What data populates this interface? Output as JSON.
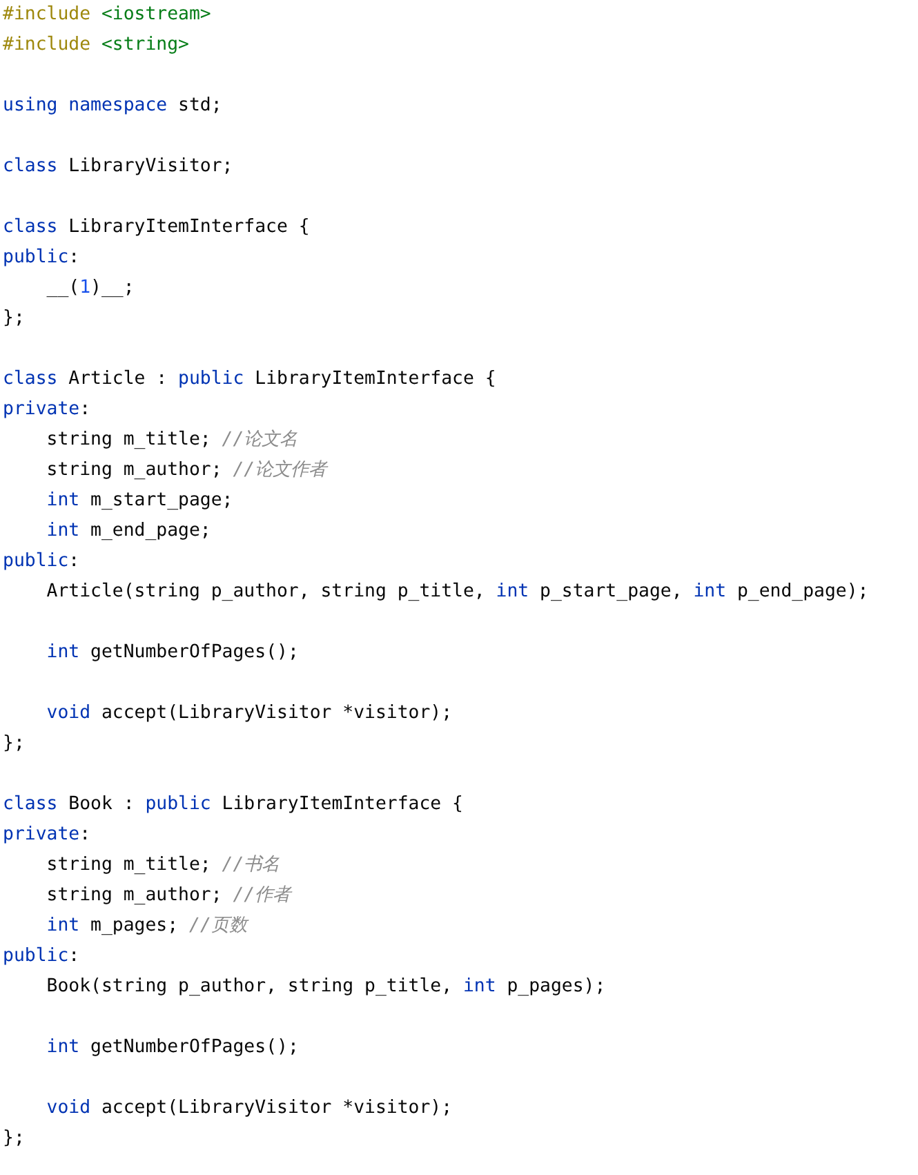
{
  "lines": [
    {
      "kind": "code",
      "tokens": [
        {
          "kind": "directive",
          "text": "#include "
        },
        {
          "kind": "string",
          "text": "<iostream>"
        }
      ]
    },
    {
      "kind": "code",
      "tokens": [
        {
          "kind": "directive",
          "text": "#include "
        },
        {
          "kind": "string",
          "text": "<string>"
        }
      ]
    },
    {
      "kind": "blank"
    },
    {
      "kind": "code",
      "tokens": [
        {
          "kind": "keyword",
          "text": "using namespace "
        },
        {
          "kind": "plain",
          "text": "std;"
        }
      ]
    },
    {
      "kind": "blank"
    },
    {
      "kind": "code",
      "tokens": [
        {
          "kind": "keyword",
          "text": "class "
        },
        {
          "kind": "plain",
          "text": "LibraryVisitor;"
        }
      ]
    },
    {
      "kind": "blank"
    },
    {
      "kind": "code",
      "tokens": [
        {
          "kind": "keyword",
          "text": "class "
        },
        {
          "kind": "plain",
          "text": "LibraryItemInterface {"
        }
      ]
    },
    {
      "kind": "code",
      "tokens": [
        {
          "kind": "keyword",
          "text": "public"
        },
        {
          "kind": "plain",
          "text": ":"
        }
      ]
    },
    {
      "kind": "code",
      "tokens": [
        {
          "kind": "plain",
          "text": "    __("
        },
        {
          "kind": "number",
          "text": "1"
        },
        {
          "kind": "plain",
          "text": ")__;"
        }
      ]
    },
    {
      "kind": "code",
      "tokens": [
        {
          "kind": "plain",
          "text": "};"
        }
      ]
    },
    {
      "kind": "blank"
    },
    {
      "kind": "code",
      "tokens": [
        {
          "kind": "keyword",
          "text": "class "
        },
        {
          "kind": "plain",
          "text": "Article : "
        },
        {
          "kind": "keyword",
          "text": "public "
        },
        {
          "kind": "plain",
          "text": "LibraryItemInterface {"
        }
      ]
    },
    {
      "kind": "code",
      "tokens": [
        {
          "kind": "keyword",
          "text": "private"
        },
        {
          "kind": "plain",
          "text": ":"
        }
      ]
    },
    {
      "kind": "code",
      "tokens": [
        {
          "kind": "plain",
          "text": "    string m_title; "
        },
        {
          "kind": "comment",
          "text": "//论文名"
        }
      ]
    },
    {
      "kind": "code",
      "tokens": [
        {
          "kind": "plain",
          "text": "    string m_author; "
        },
        {
          "kind": "comment",
          "text": "//论文作者"
        }
      ]
    },
    {
      "kind": "code",
      "tokens": [
        {
          "kind": "keyword",
          "text": "    int "
        },
        {
          "kind": "plain",
          "text": "m_start_page;"
        }
      ]
    },
    {
      "kind": "code",
      "tokens": [
        {
          "kind": "keyword",
          "text": "    int "
        },
        {
          "kind": "plain",
          "text": "m_end_page;"
        }
      ]
    },
    {
      "kind": "code",
      "tokens": [
        {
          "kind": "keyword",
          "text": "public"
        },
        {
          "kind": "plain",
          "text": ":"
        }
      ]
    },
    {
      "kind": "code",
      "tokens": [
        {
          "kind": "plain",
          "text": "    Article(string p_author, string p_title, "
        },
        {
          "kind": "keyword",
          "text": "int "
        },
        {
          "kind": "plain",
          "text": "p_start_page, "
        },
        {
          "kind": "keyword",
          "text": "int "
        },
        {
          "kind": "plain",
          "text": "p_end_page);"
        }
      ]
    },
    {
      "kind": "blank"
    },
    {
      "kind": "code",
      "tokens": [
        {
          "kind": "keyword",
          "text": "    int "
        },
        {
          "kind": "plain",
          "text": "getNumberOfPages();"
        }
      ]
    },
    {
      "kind": "blank"
    },
    {
      "kind": "code",
      "tokens": [
        {
          "kind": "keyword",
          "text": "    void "
        },
        {
          "kind": "plain",
          "text": "accept(LibraryVisitor *visitor);"
        }
      ]
    },
    {
      "kind": "code",
      "tokens": [
        {
          "kind": "plain",
          "text": "};"
        }
      ]
    },
    {
      "kind": "blank"
    },
    {
      "kind": "code",
      "tokens": [
        {
          "kind": "keyword",
          "text": "class "
        },
        {
          "kind": "plain",
          "text": "Book : "
        },
        {
          "kind": "keyword",
          "text": "public "
        },
        {
          "kind": "plain",
          "text": "LibraryItemInterface {"
        }
      ]
    },
    {
      "kind": "code",
      "tokens": [
        {
          "kind": "keyword",
          "text": "private"
        },
        {
          "kind": "plain",
          "text": ":"
        }
      ]
    },
    {
      "kind": "code",
      "tokens": [
        {
          "kind": "plain",
          "text": "    string m_title; "
        },
        {
          "kind": "comment",
          "text": "//书名"
        }
      ]
    },
    {
      "kind": "code",
      "tokens": [
        {
          "kind": "plain",
          "text": "    string m_author; "
        },
        {
          "kind": "comment",
          "text": "//作者"
        }
      ]
    },
    {
      "kind": "code",
      "tokens": [
        {
          "kind": "keyword",
          "text": "    int "
        },
        {
          "kind": "plain",
          "text": "m_pages; "
        },
        {
          "kind": "comment",
          "text": "//页数"
        }
      ]
    },
    {
      "kind": "code",
      "tokens": [
        {
          "kind": "keyword",
          "text": "public"
        },
        {
          "kind": "plain",
          "text": ":"
        }
      ]
    },
    {
      "kind": "code",
      "tokens": [
        {
          "kind": "plain",
          "text": "    Book(string p_author, string p_title, "
        },
        {
          "kind": "keyword",
          "text": "int "
        },
        {
          "kind": "plain",
          "text": "p_pages);"
        }
      ]
    },
    {
      "kind": "blank"
    },
    {
      "kind": "code",
      "tokens": [
        {
          "kind": "keyword",
          "text": "    int "
        },
        {
          "kind": "plain",
          "text": "getNumberOfPages();"
        }
      ]
    },
    {
      "kind": "blank"
    },
    {
      "kind": "code",
      "tokens": [
        {
          "kind": "keyword",
          "text": "    void "
        },
        {
          "kind": "plain",
          "text": "accept(LibraryVisitor *visitor);"
        }
      ]
    },
    {
      "kind": "code",
      "tokens": [
        {
          "kind": "plain",
          "text": "};"
        }
      ]
    }
  ]
}
